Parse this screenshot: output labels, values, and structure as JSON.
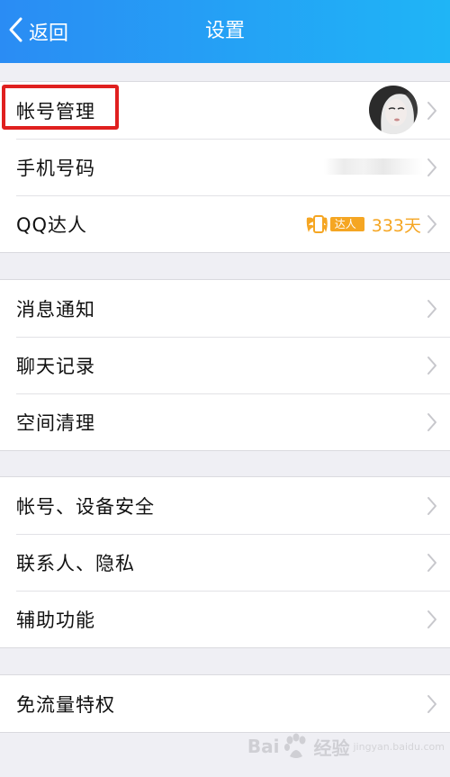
{
  "navbar": {
    "back_label": "返回",
    "title": "设置"
  },
  "groups": [
    {
      "rows": [
        {
          "label": "帐号管理",
          "name": "row-account-management"
        },
        {
          "label": "手机号码",
          "name": "row-phone-number"
        },
        {
          "label": "QQ达人",
          "name": "row-qq-daren"
        }
      ]
    },
    {
      "rows": [
        {
          "label": "消息通知",
          "name": "row-message-notification"
        },
        {
          "label": "聊天记录",
          "name": "row-chat-history"
        },
        {
          "label": "空间清理",
          "name": "row-storage-cleanup"
        }
      ]
    },
    {
      "rows": [
        {
          "label": "帐号、设备安全",
          "name": "row-account-device-security"
        },
        {
          "label": "联系人、隐私",
          "name": "row-contacts-privacy"
        },
        {
          "label": "辅助功能",
          "name": "row-accessibility"
        }
      ]
    },
    {
      "rows": [
        {
          "label": "免流量特权",
          "name": "row-free-data-privilege"
        }
      ]
    }
  ],
  "qq_daren": {
    "badge_text": "达人",
    "days": "333天"
  },
  "watermark": {
    "brand": "Bai",
    "brand_suffix": "经验",
    "sub": "jingyan.baidu.com"
  },
  "colors": {
    "navbar_start": "#2a8cf4",
    "navbar_end": "#1fb5f6",
    "highlight": "#e0201f",
    "badge": "#f5a623",
    "background": "#efeff4"
  },
  "icons": {
    "back": "chevron-left-icon",
    "row_disclosure": "chevron-right-icon",
    "badge": "qq-daren-badge-icon",
    "watermark": "baidu-paw-icon"
  }
}
